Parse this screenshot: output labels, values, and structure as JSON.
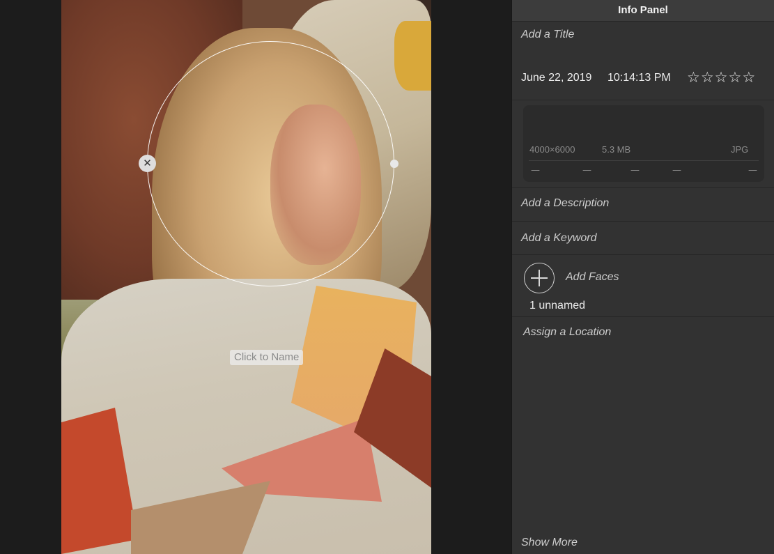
{
  "panel": {
    "title": "Info Panel",
    "add_title": "Add a Title",
    "date": "June 22, 2019",
    "time": "10:14:13 PM",
    "rating": {
      "value": 0,
      "max": 5,
      "star_glyph": "☆"
    },
    "metadata": {
      "dimensions": "4000×6000",
      "file_size": "5.3 MB",
      "format": "JPG",
      "dashes": [
        "—",
        "—",
        "—",
        "—",
        "—"
      ]
    },
    "add_description": "Add a Description",
    "add_keyword": "Add a Keyword",
    "faces": {
      "add_label": "Add Faces",
      "unnamed_count": "1 unnamed",
      "icon": "plus-circle-icon"
    },
    "assign_location": "Assign a Location",
    "show_more": "Show More"
  },
  "viewer": {
    "face_tag_label": "Click to Name",
    "remove_glyph": "✕"
  },
  "colors": {
    "panel_bg": "#323232",
    "header_bg": "#3c3c3c",
    "viewer_bg": "#1c1c1c"
  }
}
